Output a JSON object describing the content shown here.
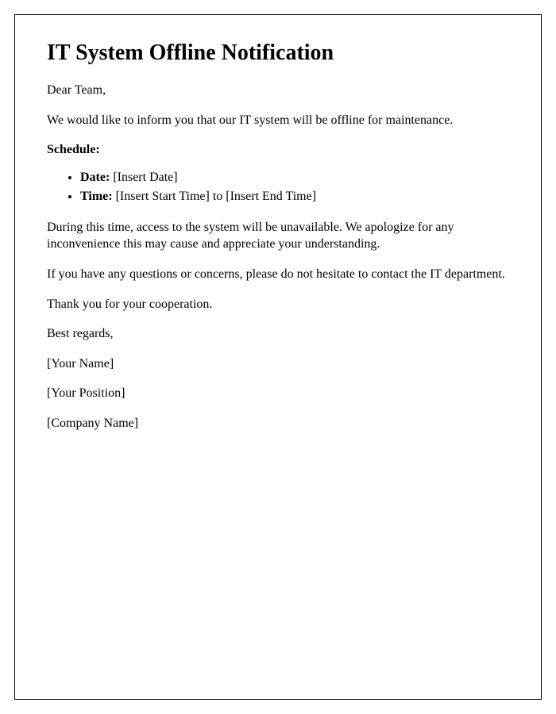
{
  "title": "IT System Offline Notification",
  "greeting": "Dear Team,",
  "intro": "We would like to inform you that our IT system will be offline for maintenance.",
  "schedule_label": "Schedule:",
  "schedule": {
    "date_label": "Date:",
    "date_value": " [Insert Date]",
    "time_label": "Time:",
    "time_value": " [Insert Start Time] to [Insert End Time]"
  },
  "body1": "During this time, access to the system will be unavailable. We apologize for any inconvenience this may cause and appreciate your understanding.",
  "body2": "If you have any questions or concerns, please do not hesitate to contact the IT department.",
  "thanks": "Thank you for your cooperation.",
  "closing": "Best regards,",
  "signature_name": "[Your Name]",
  "signature_position": "[Your Position]",
  "signature_company": "[Company Name]"
}
